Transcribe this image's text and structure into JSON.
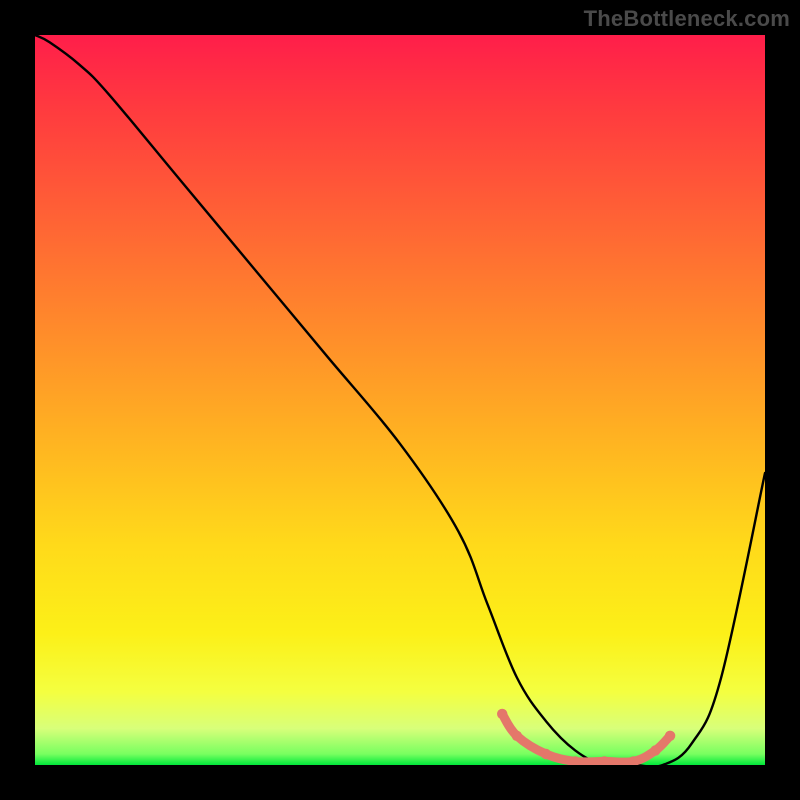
{
  "watermark": "TheBottleneck.com",
  "chart_data": {
    "type": "line",
    "title": "",
    "xlabel": "",
    "ylabel": "",
    "xlim": [
      0,
      100
    ],
    "ylim": [
      0,
      100
    ],
    "grid": false,
    "legend": false,
    "background_gradient": {
      "top": "#ff1e4a",
      "middle": "#ffda1a",
      "bottom": "#00e83a"
    },
    "series": [
      {
        "name": "bottleneck-curve",
        "color": "#000000",
        "x": [
          0,
          2,
          6,
          10,
          20,
          30,
          40,
          50,
          58,
          62,
          66,
          70,
          74,
          78,
          82,
          86,
          90,
          94,
          100
        ],
        "y": [
          100,
          99,
          96,
          92,
          80,
          68,
          56,
          44,
          32,
          22,
          12,
          6,
          2,
          0,
          0,
          0,
          3,
          12,
          40
        ]
      },
      {
        "name": "optimal-range-highlight",
        "color": "#e4776a",
        "x": [
          64,
          66,
          70,
          74,
          78,
          82,
          85,
          87
        ],
        "y": [
          7,
          4,
          1.5,
          0.5,
          0.5,
          0.5,
          2,
          4
        ]
      }
    ],
    "annotations": []
  }
}
